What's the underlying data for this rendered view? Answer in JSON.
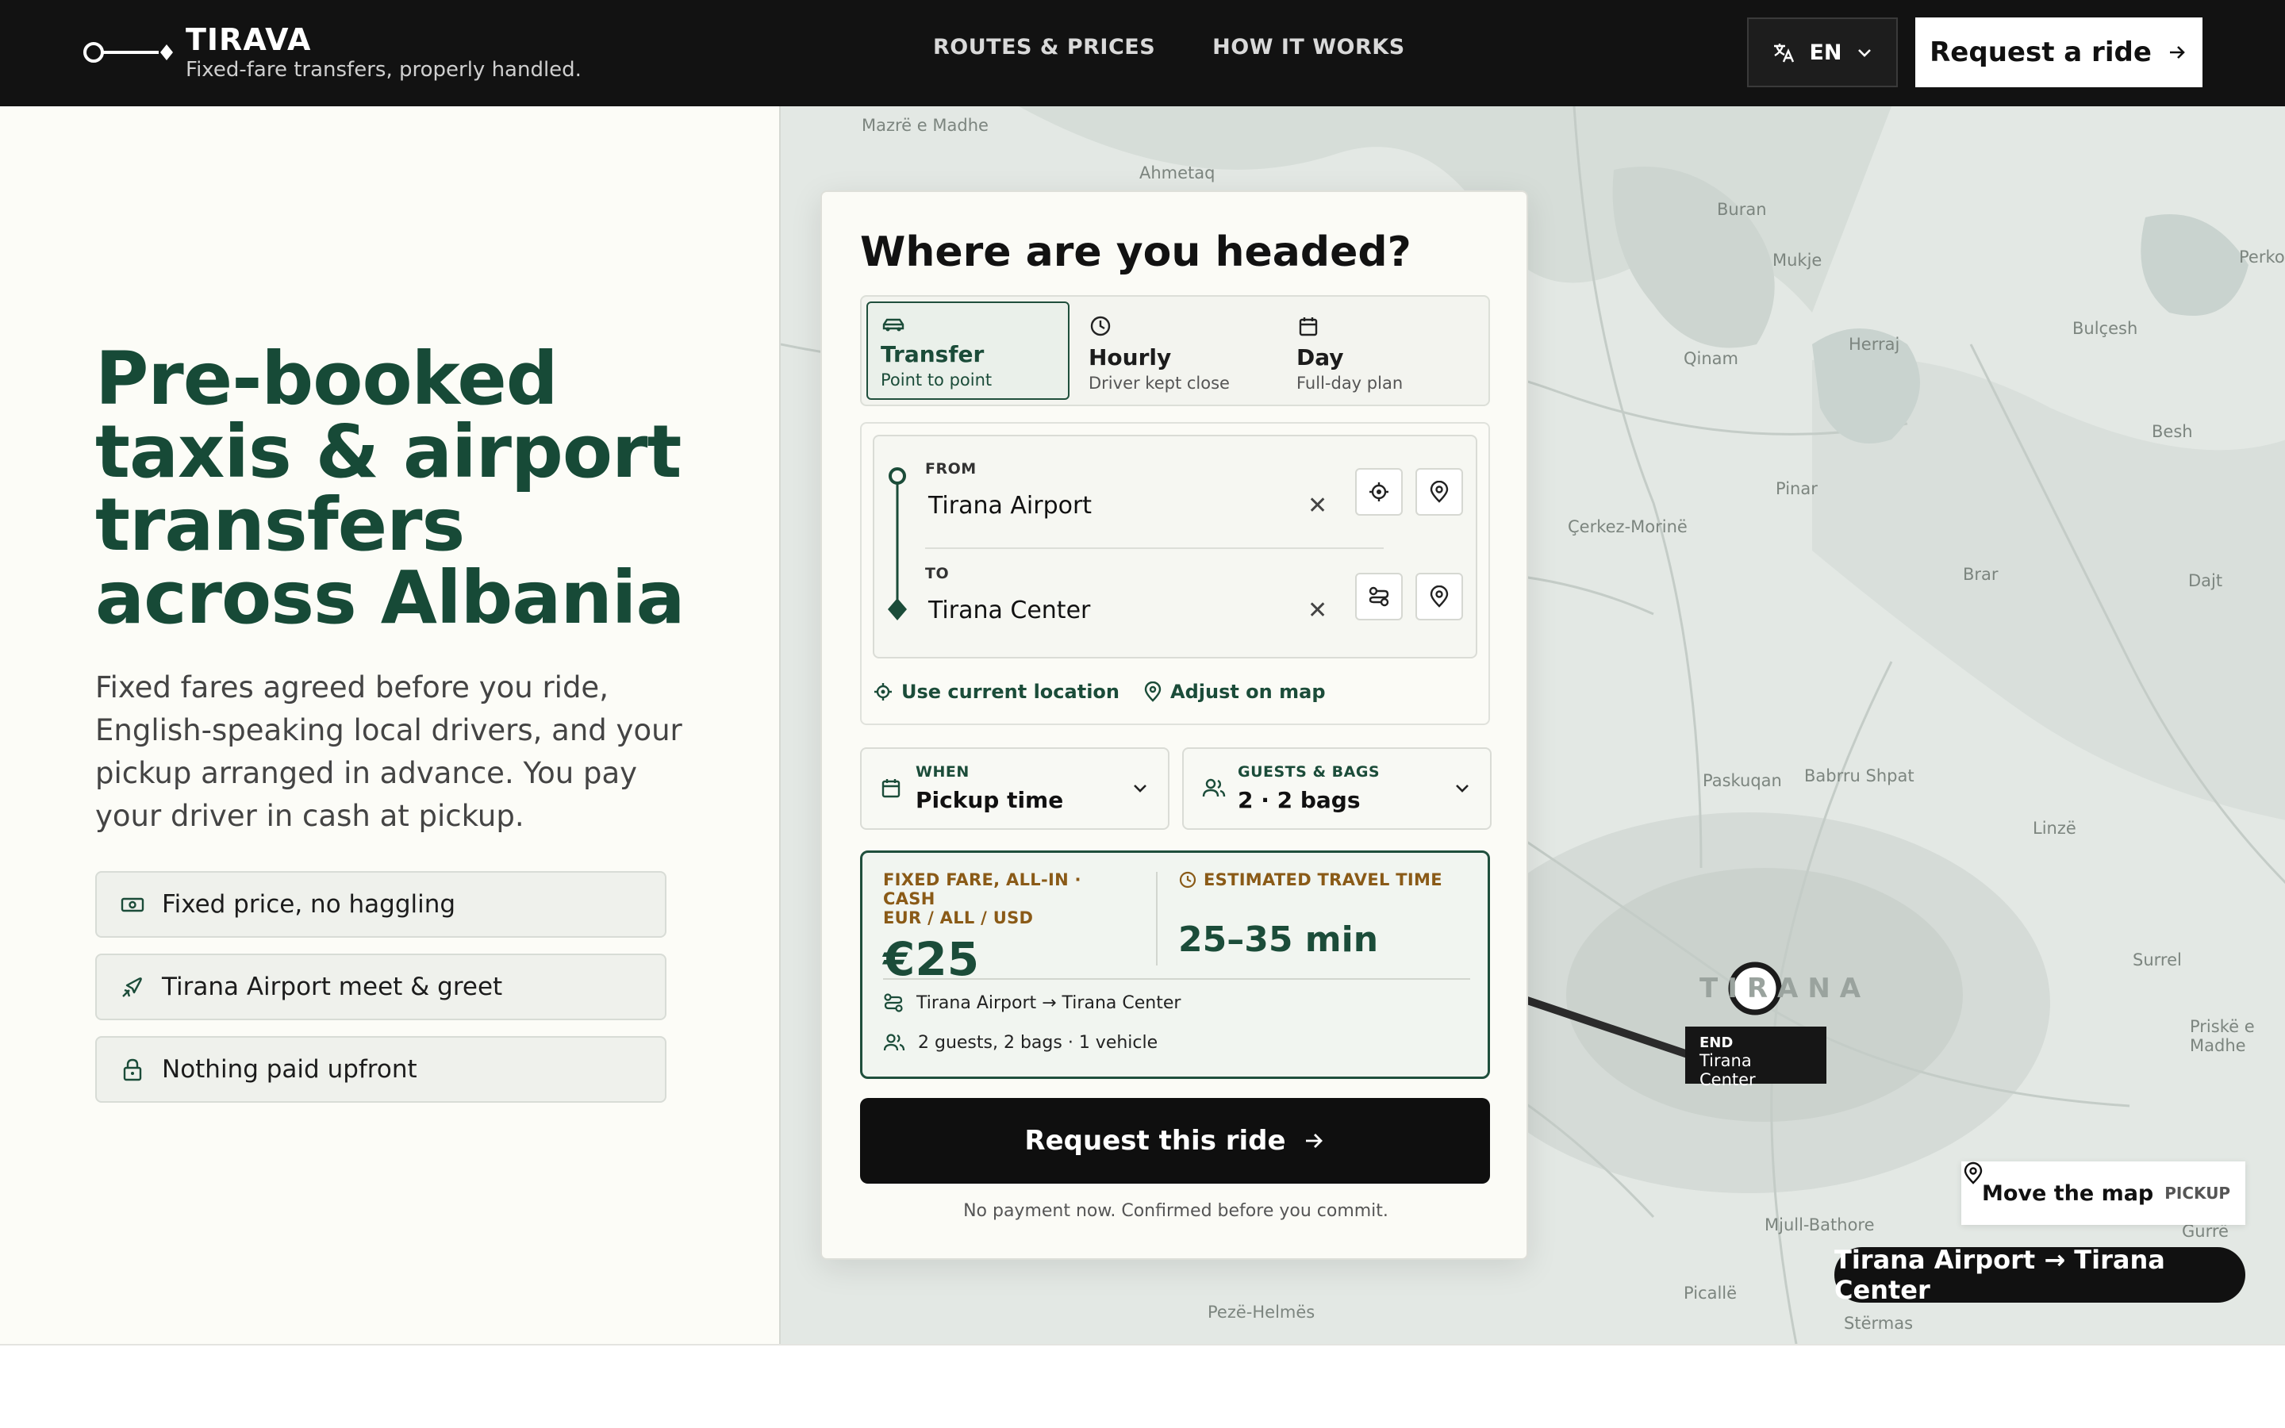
{
  "header": {
    "brand_name": "TIRAVA",
    "brand_tagline": "Fixed-fare transfers, properly handled.",
    "nav": [
      "ROUTES & PRICES",
      "HOW IT WORKS"
    ],
    "language": "EN",
    "cta": "Request a ride"
  },
  "hero": {
    "title_lines": [
      "Pre-booked",
      "taxis & airport",
      "transfers",
      "across Albania"
    ],
    "description": "Fixed fares agreed before you ride, English-speaking local drivers, and your pickup arranged in advance. You pay your driver in cash at pickup.",
    "features": [
      "Fixed price, no haggling",
      "Tirana Airport meet & greet",
      "Nothing paid upfront"
    ]
  },
  "booking": {
    "title": "Where are you headed?",
    "modes": [
      {
        "title": "Transfer",
        "subtitle": "Point to point"
      },
      {
        "title": "Hourly",
        "subtitle": "Driver kept close"
      },
      {
        "title": "Day",
        "subtitle": "Full-day plan"
      }
    ],
    "from_label": "FROM",
    "from_value": "Tirana Airport",
    "to_label": "TO",
    "to_value": "Tirana Center",
    "use_location": "Use current location",
    "adjust_map": "Adjust on map",
    "when_label": "WHEN",
    "when_value": "Pickup time",
    "guests_label": "GUESTS & BAGS",
    "guests_value": "2 · 2 bags",
    "fare_label": "FIXED FARE, ALL-IN · CASH",
    "fare_currencies": "EUR / ALL / USD",
    "fare_price": "€25",
    "time_label": "ESTIMATED TRAVEL TIME",
    "time_value": "25–35 min",
    "summary_route": "Tirana Airport → Tirana Center",
    "summary_party": "2 guests, 2 bags · 1 vehicle",
    "submit": "Request this ride",
    "fine_print": "No payment now. Confirmed before you commit."
  },
  "map": {
    "places": [
      "Mazrë e Madhe",
      "Ahmetaq",
      "Buran",
      "Mukje",
      "Perko",
      "Qinam",
      "Herraj",
      "Bulçesh",
      "Besh",
      "Pinar",
      "Çerkez-Morinë",
      "Brar",
      "Dajt",
      "Paskuqan",
      "Babrru Shpat",
      "Linzë",
      "Surrel",
      "Priskë e Madhe",
      "Mjull-Bathore",
      "Gurrë",
      "Picallë",
      "Pezë-Helmës",
      "Stërmas",
      "TIRANA"
    ],
    "end_tag": "END",
    "end_place": "Tirana Center",
    "move_map": "Move the map",
    "move_map_mode": "PICKUP",
    "route_chip": "Tirana Airport → Tirana Center"
  },
  "colors": {
    "brand_green": "#174a37",
    "fare_accent": "#8a5a17",
    "dark": "#121212"
  }
}
